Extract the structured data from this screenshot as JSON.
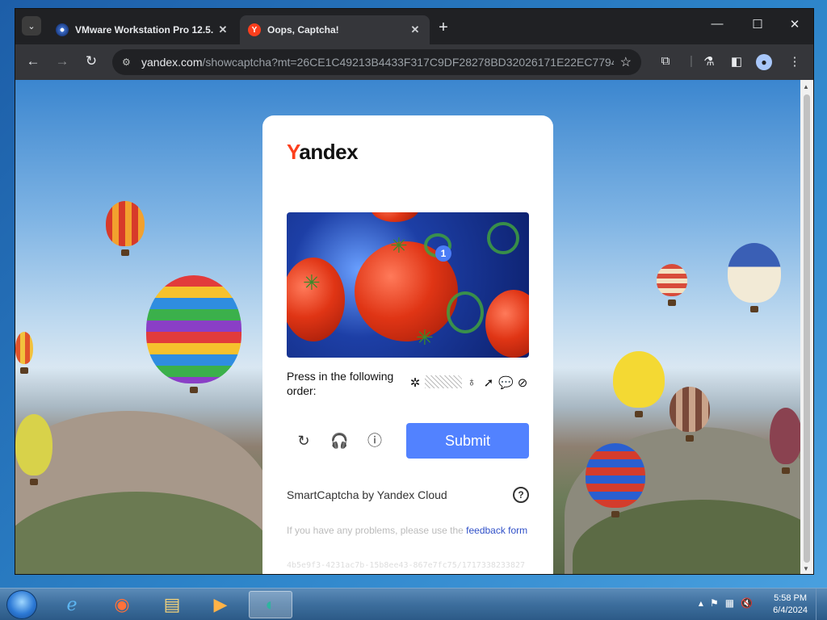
{
  "tabs": [
    {
      "title": "VMware Workstation Pro 12.5.",
      "icon": "vmware-icon",
      "active": false
    },
    {
      "title": "Oops, Captcha!",
      "icon": "yandex-icon",
      "active": true
    }
  ],
  "omnibox": {
    "host": "yandex.com",
    "path": "/showcaptcha?mt=26CE1C49213B4433F317C9DF28278BD32026171E22EC77944..."
  },
  "captcha": {
    "logo_y": "Y",
    "logo_rest": "andex",
    "marker_number": "1",
    "instruction": "Press in the following order:",
    "icon_sequence": [
      "gear-blob-icon",
      "hatched-blank-icon",
      "bag-icon",
      "cursor-icon",
      "speech-bubble-icon",
      "ball-icon"
    ],
    "submit_label": "Submit",
    "smart_label": "SmartCaptcha by Yandex Cloud",
    "help_label": "?",
    "feedback_text": "If you have any problems, please use the ",
    "feedback_link": "feedback form",
    "token": "4b5e9f3-4231ac7b-15b8ee43-867e7fc75/1717338233827"
  },
  "taskbar": {
    "apps": [
      "internet-explorer-icon",
      "firefox-icon",
      "file-explorer-icon",
      "media-player-icon",
      "chrome-like-icon"
    ],
    "time": "5:58 PM",
    "date": "6/4/2024"
  },
  "colors": {
    "yandex_red": "#fc3f1d",
    "submit_blue": "#5282ff",
    "link_blue": "#3050c8"
  }
}
